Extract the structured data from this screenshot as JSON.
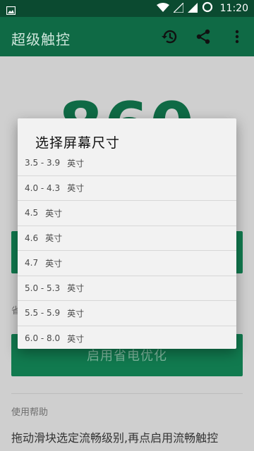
{
  "status_bar": {
    "time": "11:20",
    "icons": [
      "image-icon",
      "wifi-icon",
      "signal-icon",
      "battery-icon"
    ]
  },
  "app_bar": {
    "title": "超级触控",
    "actions": [
      "history-icon",
      "share-icon",
      "more-vert-icon"
    ]
  },
  "main": {
    "big_number": "860",
    "side_label": "省",
    "primary_button": "启用省电优化",
    "help_label": "使用帮助",
    "help_text": "拖动滑块选定流畅级别,再点启用流畅触控"
  },
  "dialog": {
    "title": "选择屏幕尺寸",
    "unit": "英寸",
    "options": [
      {
        "range": "3.5 - 3.9"
      },
      {
        "range": "4.0 - 4.3"
      },
      {
        "range": "4.5"
      },
      {
        "range": "4.6"
      },
      {
        "range": "4.7"
      },
      {
        "range": "5.0 - 5.3"
      },
      {
        "range": "5.5 - 5.9"
      },
      {
        "range": "6.0 - 8.0"
      }
    ]
  },
  "colors": {
    "primary": "#0f6a45",
    "status_bar": "#0b4a30",
    "button": "#117a4f"
  }
}
